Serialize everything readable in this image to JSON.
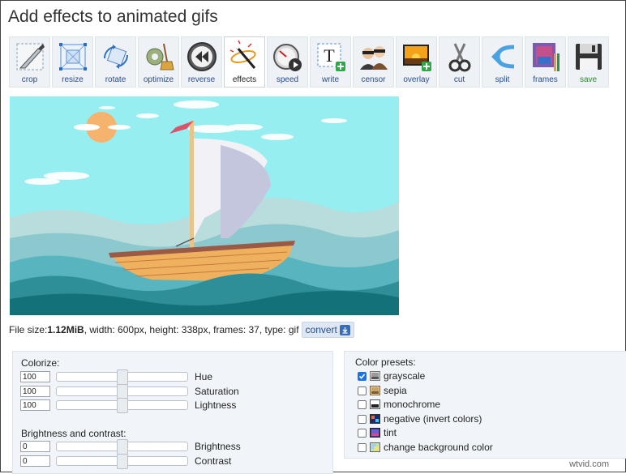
{
  "page": {
    "title": "Add effects to animated gifs"
  },
  "toolbar": {
    "active": "effects",
    "tools": [
      {
        "id": "crop",
        "label": "crop",
        "icon": "crop-knife-icon"
      },
      {
        "id": "resize",
        "label": "resize",
        "icon": "resize-icon"
      },
      {
        "id": "rotate",
        "label": "rotate",
        "icon": "rotate-icon"
      },
      {
        "id": "optimize",
        "label": "optimize",
        "icon": "optimize-broom-icon"
      },
      {
        "id": "reverse",
        "label": "reverse",
        "icon": "reverse-icon"
      },
      {
        "id": "effects",
        "label": "effects",
        "icon": "magic-wand-icon"
      },
      {
        "id": "speed",
        "label": "speed",
        "icon": "speedometer-icon"
      },
      {
        "id": "write",
        "label": "write",
        "icon": "text-add-icon"
      },
      {
        "id": "censor",
        "label": "censor",
        "icon": "censor-faces-icon"
      },
      {
        "id": "overlay",
        "label": "overlay",
        "icon": "overlay-image-icon"
      },
      {
        "id": "cut",
        "label": "cut",
        "icon": "scissors-icon"
      },
      {
        "id": "split",
        "label": "split",
        "icon": "split-arrow-icon"
      },
      {
        "id": "frames",
        "label": "frames",
        "icon": "frames-icon"
      },
      {
        "id": "save",
        "label": "save",
        "icon": "floppy-disk-icon"
      }
    ]
  },
  "fileinfo": {
    "prefix": "File size: ",
    "size": "1.12MiB",
    "details": ", width: 600px, height: 338px, frames: 37, type: gif",
    "convert_label": "convert"
  },
  "colorize": {
    "title": "Colorize:",
    "controls": [
      {
        "label": "Hue",
        "value": "100",
        "level": 0.5
      },
      {
        "label": "Saturation",
        "value": "100",
        "level": 0.5
      },
      {
        "label": "Lightness",
        "value": "100",
        "level": 0.5
      }
    ]
  },
  "brightness_contrast": {
    "title": "Brightness and contrast:",
    "controls": [
      {
        "label": "Brightness",
        "value": "0",
        "level": 0.5
      },
      {
        "label": "Contrast",
        "value": "0",
        "level": 0.5
      }
    ]
  },
  "color_presets": {
    "title": "Color presets:",
    "items": [
      {
        "label": "grayscale",
        "checked": true,
        "icon": "grayscale-preset-icon"
      },
      {
        "label": "sepia",
        "checked": false,
        "icon": "sepia-preset-icon"
      },
      {
        "label": "monochrome",
        "checked": false,
        "icon": "monochrome-preset-icon"
      },
      {
        "label": "negative (invert colors)",
        "checked": false,
        "icon": "negative-preset-icon"
      },
      {
        "label": "tint",
        "checked": false,
        "icon": "tint-preset-icon"
      },
      {
        "label": "change background color",
        "checked": false,
        "icon": "background-color-preset-icon"
      }
    ]
  },
  "watermark": {
    "text": "wtvid.com"
  },
  "colors": {
    "link_blue": "#2a4c8a",
    "save_green": "#2b8a2b",
    "panel_bg": "#f1f5f9",
    "sky": "#96eef0",
    "sea_dark": "#13717a"
  }
}
